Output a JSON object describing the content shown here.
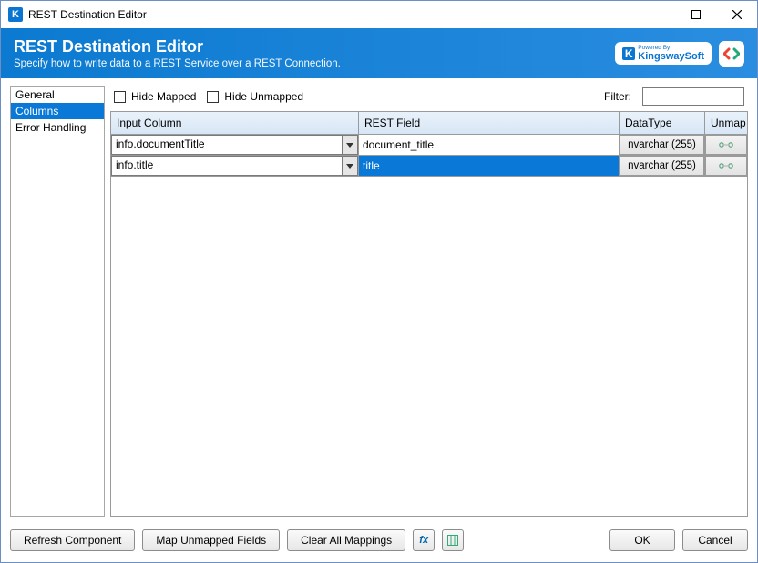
{
  "window": {
    "title": "REST Destination Editor"
  },
  "header": {
    "title": "REST Destination Editor",
    "subtitle": "Specify how to write data to a REST Service over a REST Connection.",
    "poweredBy": "Powered By",
    "brand": "KingswaySoft"
  },
  "sidebar": {
    "items": [
      {
        "label": "General"
      },
      {
        "label": "Columns"
      },
      {
        "label": "Error Handling"
      }
    ],
    "selectedIndex": 1
  },
  "toolbar": {
    "hideMapped": "Hide Mapped",
    "hideUnmapped": "Hide Unmapped",
    "filterLabel": "Filter:",
    "filterValue": ""
  },
  "grid": {
    "headers": {
      "inputColumn": "Input Column",
      "restField": "REST Field",
      "dataType": "DataType",
      "unmap": "Unmap"
    },
    "rows": [
      {
        "input": "info.documentTitle",
        "rest": "document_title",
        "dataType": "nvarchar (255)"
      },
      {
        "input": "info.title",
        "rest": "title",
        "dataType": "nvarchar (255)"
      }
    ],
    "selectedIndex": 1
  },
  "buttons": {
    "refresh": "Refresh Component",
    "mapUnmapped": "Map Unmapped Fields",
    "clearAll": "Clear All Mappings",
    "ok": "OK",
    "cancel": "Cancel"
  }
}
